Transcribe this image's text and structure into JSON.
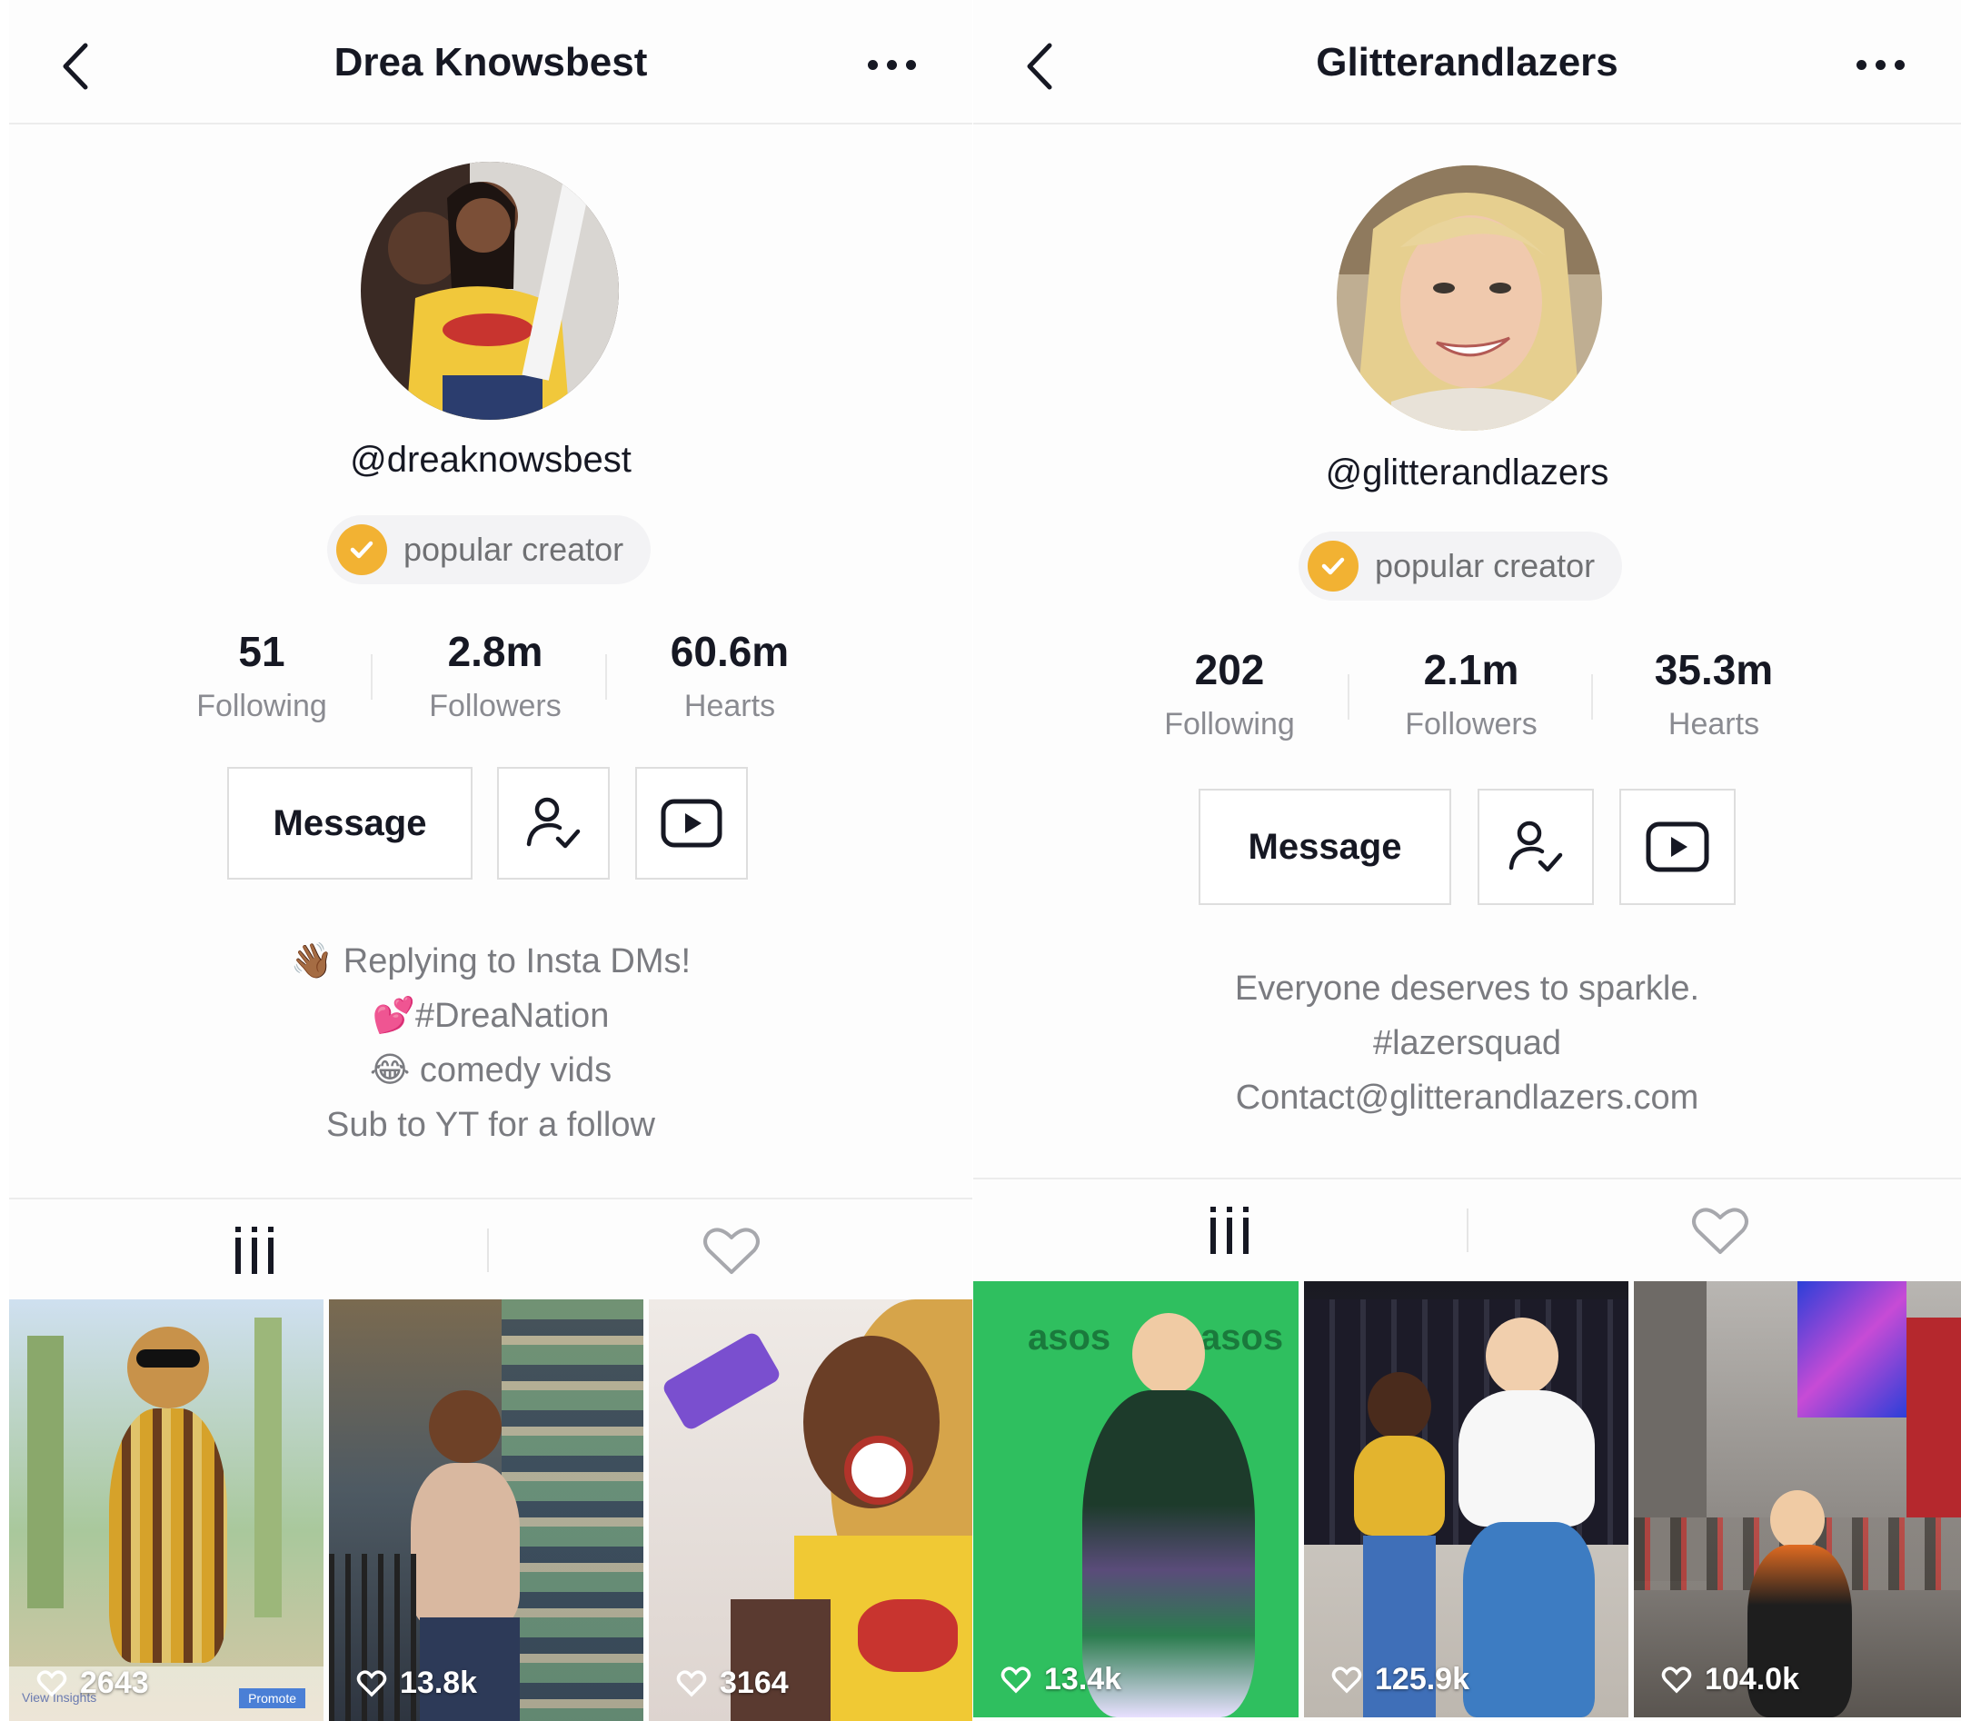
{
  "left_profile": {
    "title": "Drea Knowsbest",
    "handle": "@dreaknowsbest",
    "badge": "popular creator",
    "stats": {
      "following_value": "51",
      "following_label": "Following",
      "followers_value": "2.8m",
      "followers_label": "Followers",
      "hearts_value": "60.6m",
      "hearts_label": "Hearts"
    },
    "message_label": "Message",
    "bio": [
      "👋🏾 Replying to Insta DMs!",
      "💕#DreaNation",
      "😂 comedy vids",
      "Sub to YT for a follow"
    ],
    "videos": [
      {
        "likes": "2643",
        "overlay_left": "View Insights",
        "overlay_right": "Promote"
      },
      {
        "likes": "13.8k"
      },
      {
        "likes": "3164"
      }
    ]
  },
  "right_profile": {
    "title": "Glitterandlazers",
    "handle": "@glitterandlazers",
    "badge": "popular creator",
    "stats": {
      "following_value": "202",
      "following_label": "Following",
      "followers_value": "2.1m",
      "followers_label": "Followers",
      "hearts_value": "35.3m",
      "hearts_label": "Hearts"
    },
    "message_label": "Message",
    "bio": [
      "Everyone deserves to sparkle.",
      "#lazersquad",
      "Contact@glitterandlazers.com"
    ],
    "videos": [
      {
        "likes": "13.4k",
        "backdrop_text": "asos"
      },
      {
        "likes": "125.9k"
      },
      {
        "likes": "104.0k"
      }
    ]
  },
  "icons": {
    "back": "chevron-left-icon",
    "more": "more-dots-icon",
    "badge": "check-badge-icon",
    "follow": "user-check-icon",
    "youtube": "youtube-play-icon",
    "videos_tab": "grid-bars-icon",
    "liked_tab": "heart-outline-icon",
    "likes": "heart-outline-icon"
  },
  "colors": {
    "badge_accent": "#f2b233",
    "text_primary": "#161823",
    "text_secondary": "#8a8b91"
  }
}
